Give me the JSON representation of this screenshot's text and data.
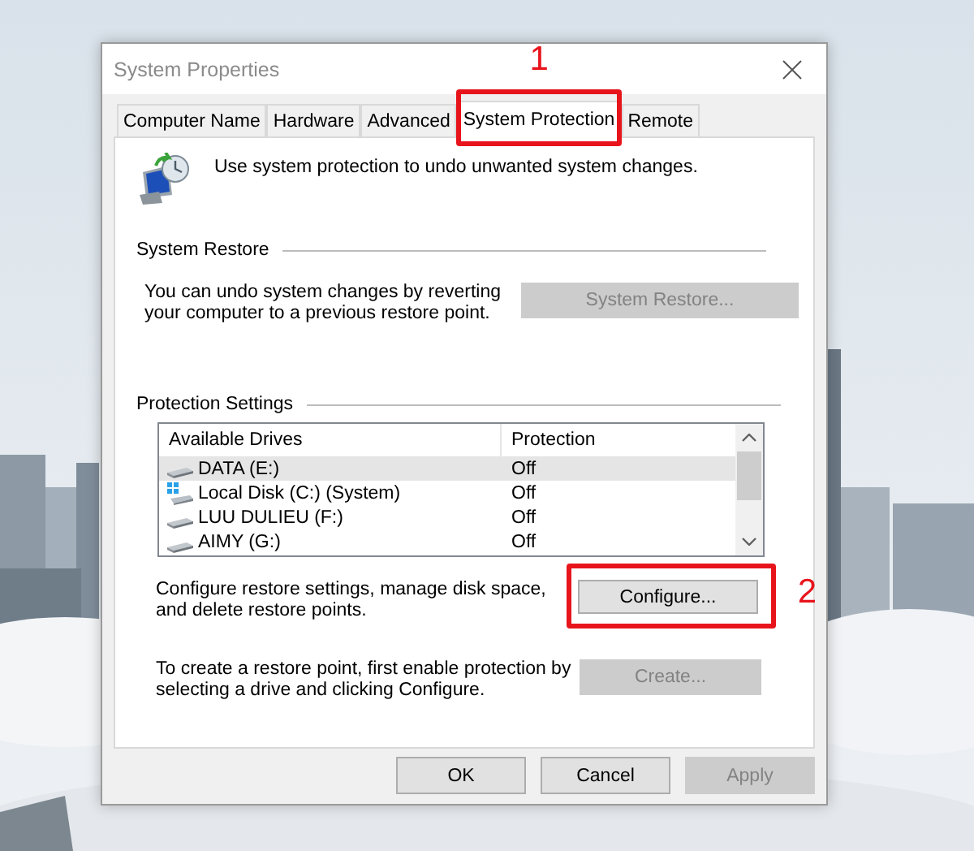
{
  "window": {
    "title": "System Properties"
  },
  "tabs": [
    {
      "label": "Computer Name",
      "selected": false
    },
    {
      "label": "Hardware",
      "selected": false
    },
    {
      "label": "Advanced",
      "selected": false
    },
    {
      "label": "System Protection",
      "selected": true,
      "callout": "1"
    },
    {
      "label": "Remote",
      "selected": false
    }
  ],
  "intro": "Use system protection to undo unwanted system changes.",
  "system_restore": {
    "heading": "System Restore",
    "text": "You can undo system changes by reverting your computer to a previous restore point.",
    "button": {
      "label": "System Restore...",
      "disabled": true
    }
  },
  "protection_settings": {
    "heading": "Protection Settings",
    "columns": [
      "Available Drives",
      "Protection"
    ],
    "drives": [
      {
        "name": "DATA (E:)",
        "protection": "Off",
        "kind": "drive",
        "selected": true
      },
      {
        "name": "Local Disk (C:) (System)",
        "protection": "Off",
        "kind": "system",
        "selected": false
      },
      {
        "name": "LUU DULIEU (F:)",
        "protection": "Off",
        "kind": "drive",
        "selected": false
      },
      {
        "name": "AIMY (G:)",
        "protection": "Off",
        "kind": "drive",
        "selected": false
      }
    ],
    "configure_text": "Configure restore settings, manage disk space, and delete restore points.",
    "configure_button": {
      "label": "Configure...",
      "disabled": false,
      "callout": "2"
    },
    "create_text": "To create a restore point, first enable protection by selecting a drive and clicking Configure.",
    "create_button": {
      "label": "Create...",
      "disabled": true
    }
  },
  "buttons": [
    {
      "label": "OK",
      "disabled": false
    },
    {
      "label": "Cancel",
      "disabled": false
    },
    {
      "label": "Apply",
      "disabled": true
    }
  ]
}
